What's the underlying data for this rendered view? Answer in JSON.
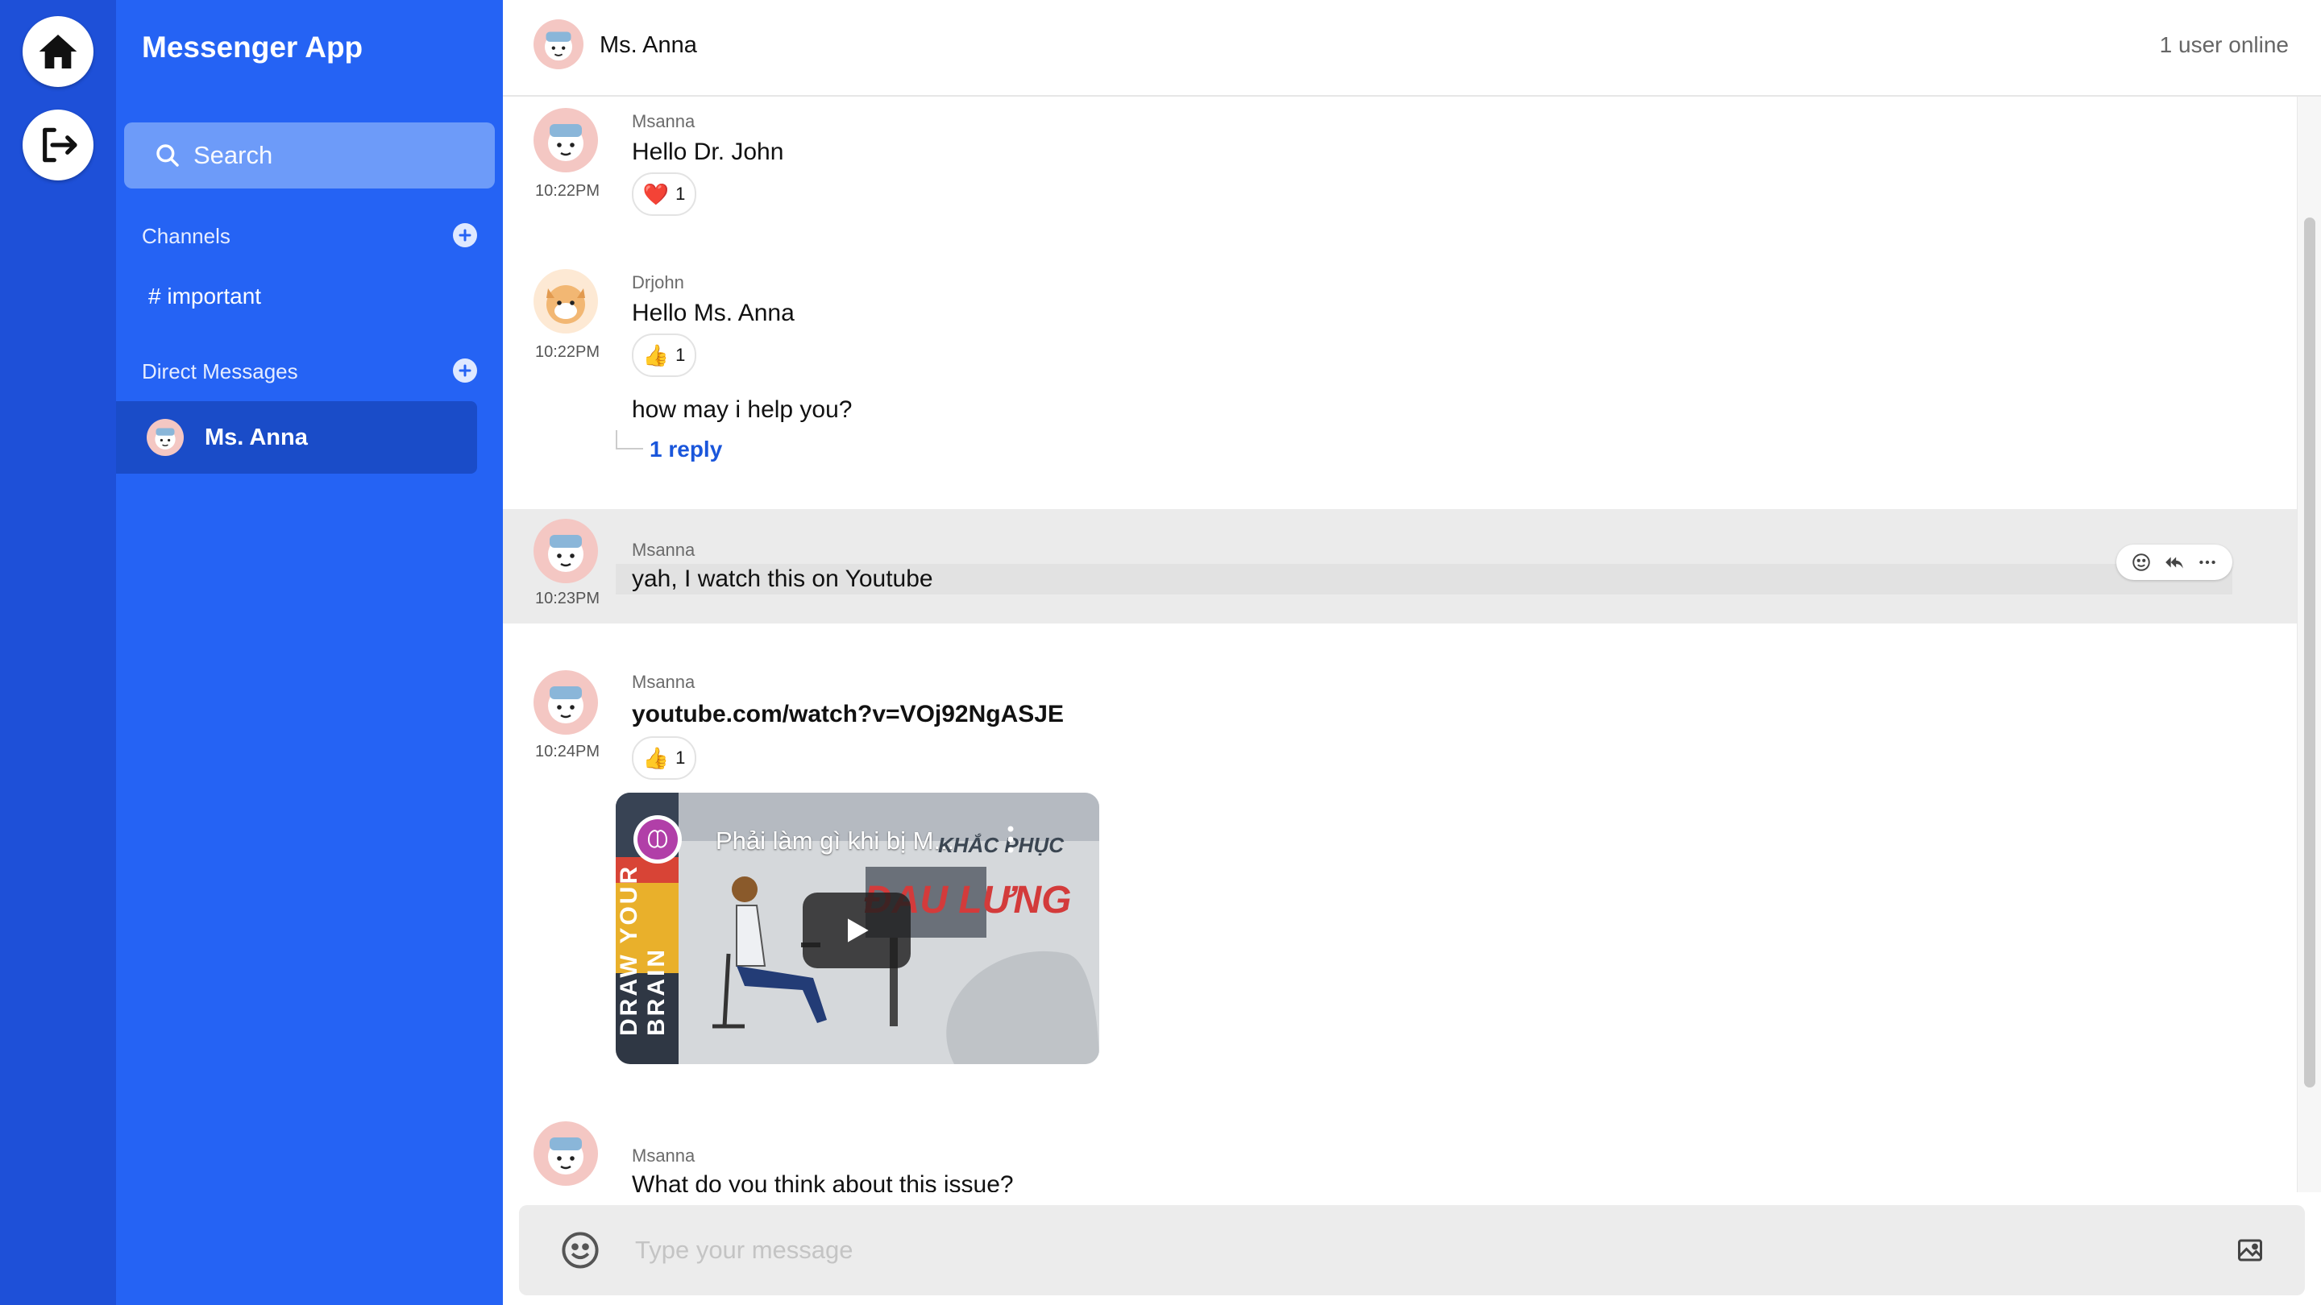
{
  "app": {
    "title": "Messenger App"
  },
  "rail": {
    "home": "home-icon",
    "logout": "logout-icon"
  },
  "sidebar": {
    "search_placeholder": "Search",
    "channels_label": "Channels",
    "channels": [
      "# important"
    ],
    "dm_label": "Direct Messages",
    "dms": [
      {
        "name": "Ms. Anna",
        "active": true
      }
    ]
  },
  "header": {
    "name": "Ms. Anna",
    "status": "1 user online"
  },
  "messages": [
    {
      "author": "Msanna",
      "time": "10:22PM",
      "text": "Hello Dr. John",
      "reaction": {
        "emoji": "❤️",
        "count": "1"
      }
    },
    {
      "author": "Drjohn",
      "time": "10:22PM",
      "text": "Hello Ms. Anna",
      "reaction": {
        "emoji": "👍",
        "count": "1"
      },
      "followup": "how may i help you?",
      "replies": "1 reply"
    },
    {
      "author": "Msanna",
      "time": "10:23PM",
      "text": "yah, I watch this on Youtube",
      "hovered": true
    },
    {
      "author": "Msanna",
      "time": "10:24PM",
      "text": "youtube.com/watch?v=VOj92NgASJE",
      "reaction": {
        "emoji": "👍",
        "count": "1"
      },
      "video": {
        "title": "Phải làm gì khi bị M...",
        "overlay_top": "KHẮC PHỤC",
        "overlay_main": "ĐAU LƯNG",
        "side_text": "DRAW YOUR BRAIN"
      }
    },
    {
      "author": "Msanna",
      "time": "",
      "text": "What do you think about this issue?"
    }
  ],
  "composer": {
    "placeholder": "Type your message"
  },
  "colors": {
    "rail": "#1e50d8",
    "sidebar": "#2563f4",
    "active_dm": "#1a4cc8",
    "link": "#1a56db"
  }
}
